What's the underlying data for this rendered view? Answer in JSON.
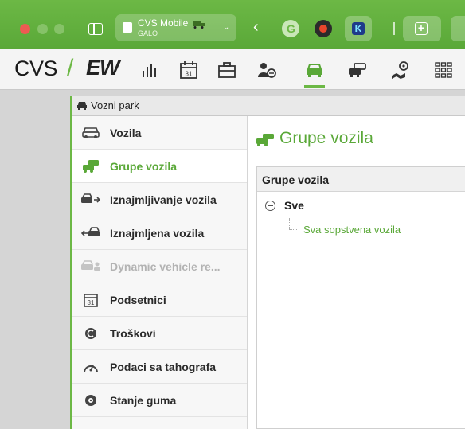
{
  "browser": {
    "tab_group_title": "CVS Mobile",
    "tab_group_subtitle": "GALO",
    "ext_k_label": "K"
  },
  "toolbar": {
    "brand_cvs": "CVS",
    "brand_slash": "/",
    "brand_ew": "EW",
    "calendar_day": "31"
  },
  "module": {
    "title": "Vozni park"
  },
  "nav": {
    "items": [
      {
        "label": "Vozila",
        "icon": "vehicles-icon"
      },
      {
        "label": "Grupe vozila",
        "icon": "vehicle-groups-icon"
      },
      {
        "label": "Iznajmljivanje vozila",
        "icon": "rent-out-icon"
      },
      {
        "label": "Iznajmljena vozila",
        "icon": "rented-icon"
      },
      {
        "label": "Dynamic vehicle re...",
        "icon": "dynamic-vehicle-icon"
      },
      {
        "label": "Podsetnici",
        "icon": "calendar-icon"
      },
      {
        "label": "Troškovi",
        "icon": "costs-icon"
      },
      {
        "label": "Podaci sa tahografa",
        "icon": "tachograph-icon"
      },
      {
        "label": "Stanje guma",
        "icon": "tire-icon"
      }
    ],
    "calendar_day": "31"
  },
  "content": {
    "title": "Grupe vozila",
    "panel_header": "Grupe vozila",
    "tree_root": "Sve",
    "tree_child": "Sva sopstvena vozila"
  },
  "colors": {
    "accent": "#6cb845",
    "accent_text": "#5aa838",
    "titlebar": "#62af3e"
  }
}
